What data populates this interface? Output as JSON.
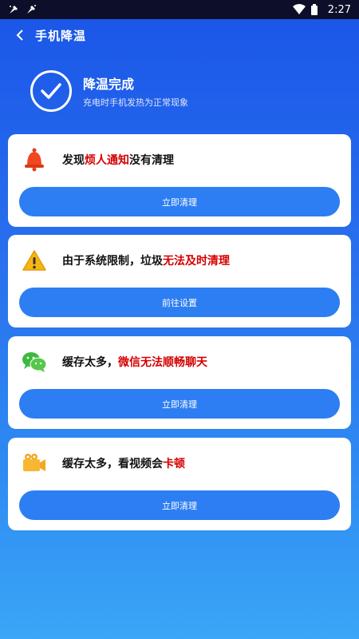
{
  "statusbar": {
    "time": "2:27"
  },
  "header": {
    "title": "手机降温"
  },
  "result": {
    "title": "降温完成",
    "subtitle": "充电时手机发热为正常现象"
  },
  "cards": [
    {
      "icon": "bell-icon",
      "text_pre": "发现",
      "text_hl": "烦人通知",
      "text_post": "没有清理",
      "button": "立即清理"
    },
    {
      "icon": "warning-icon",
      "text_pre": "由于系统限制，垃圾",
      "text_hl": "无法及时清理",
      "text_post": "",
      "button": "前往设置"
    },
    {
      "icon": "wechat-icon",
      "text_pre": "缓存太多，",
      "text_hl": "微信无法顺畅聊天",
      "text_post": "",
      "button": "立即清理"
    },
    {
      "icon": "video-camera-icon",
      "text_pre": "缓存太多，看视频会",
      "text_hl": "卡顿",
      "text_post": "",
      "button": "立即清理"
    }
  ],
  "colors": {
    "accent": "#2d7ef2",
    "highlight": "#d40000",
    "background_top": "#1a55e8",
    "background_bottom": "#3aa6f6"
  }
}
